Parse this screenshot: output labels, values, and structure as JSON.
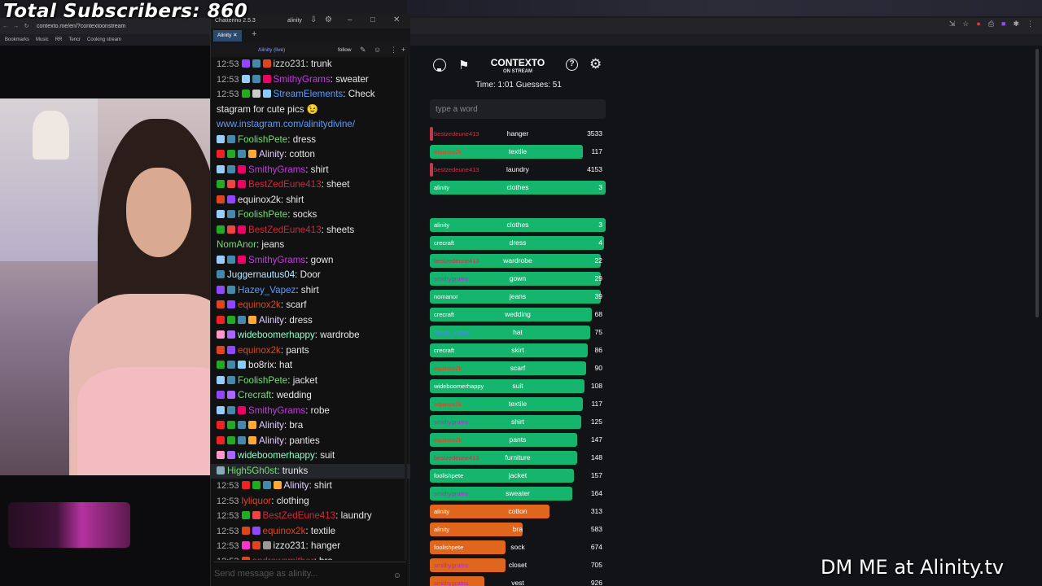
{
  "overlay": {
    "subscribers": "Total Subscribers: 860",
    "dm_text": "DM ME at Alinity.tv"
  },
  "browser": {
    "url": "contexto.me/en/?contextoonstream",
    "bookmarks": [
      "Bookmarks",
      "Music",
      "RR",
      "Tencr",
      "Cooking stream"
    ]
  },
  "game": {
    "title": "CONTEXTO",
    "subtitle": "ON STREAM",
    "stats": "Time: 1:01    Guesses: 51",
    "input_placeholder": "type a word",
    "recent": [
      {
        "player": "bestzedeune413",
        "word": "hanger",
        "rank": 3533,
        "fill": 0,
        "color": "#1b1c20",
        "pcolor": "#c23a4a"
      },
      {
        "player": "equinox2k",
        "word": "textile",
        "rank": 117,
        "fill": 0.87,
        "color": "#16b56e",
        "pcolor": "#e0441e"
      },
      {
        "player": "bestzedeune413",
        "word": "laundry",
        "rank": 4153,
        "fill": 0,
        "color": "#1b1c20",
        "pcolor": "#c23a4a"
      },
      {
        "player": "alinity",
        "word": "clothes",
        "rank": 3,
        "fill": 1,
        "color": "#16b56e",
        "pcolor": "#ffffff"
      }
    ],
    "guesses": [
      {
        "player": "alinity",
        "word": "clothes",
        "rank": 3,
        "fill": 1,
        "color": "#16b56e",
        "pcolor": "#ffffff"
      },
      {
        "player": "crecraft",
        "word": "dress",
        "rank": 4,
        "fill": 0.99,
        "color": "#16b56e",
        "pcolor": "#ffffff"
      },
      {
        "player": "bestzedeune413",
        "word": "wardrobe",
        "rank": 22,
        "fill": 0.97,
        "color": "#16b56e",
        "pcolor": "#c23a4a"
      },
      {
        "player": "smithygrams",
        "word": "gown",
        "rank": 29,
        "fill": 0.97,
        "color": "#16b56e",
        "pcolor": "#b02ad6"
      },
      {
        "player": "nomanor",
        "word": "jeans",
        "rank": 39,
        "fill": 0.97,
        "color": "#16b56e",
        "pcolor": "#ffffff"
      },
      {
        "player": "crecraft",
        "word": "wedding",
        "rank": 68,
        "fill": 0.92,
        "color": "#16b56e",
        "pcolor": "#ffffff"
      },
      {
        "player": "hazey_vapez",
        "word": "hat",
        "rank": 75,
        "fill": 0.91,
        "color": "#16b56e",
        "pcolor": "#4a8aff"
      },
      {
        "player": "crecraft",
        "word": "skirt",
        "rank": 86,
        "fill": 0.9,
        "color": "#16b56e",
        "pcolor": "#ffffff"
      },
      {
        "player": "equinox2k",
        "word": "scarf",
        "rank": 90,
        "fill": 0.89,
        "color": "#16b56e",
        "pcolor": "#e0441e"
      },
      {
        "player": "wideboomerhappy",
        "word": "suit",
        "rank": 108,
        "fill": 0.88,
        "color": "#16b56e",
        "pcolor": "#ffffff"
      },
      {
        "player": "equinox2k",
        "word": "textile",
        "rank": 117,
        "fill": 0.87,
        "color": "#16b56e",
        "pcolor": "#e0441e"
      },
      {
        "player": "smithygrams",
        "word": "shirt",
        "rank": 125,
        "fill": 0.86,
        "color": "#16b56e",
        "pcolor": "#b02ad6"
      },
      {
        "player": "equinox2k",
        "word": "pants",
        "rank": 147,
        "fill": 0.84,
        "color": "#16b56e",
        "pcolor": "#e0441e"
      },
      {
        "player": "bestzedeune413",
        "word": "furniture",
        "rank": 148,
        "fill": 0.84,
        "color": "#16b56e",
        "pcolor": "#c23a4a"
      },
      {
        "player": "foolishpete",
        "word": "jacket",
        "rank": 157,
        "fill": 0.82,
        "color": "#16b56e",
        "pcolor": "#ffffff"
      },
      {
        "player": "smithygrams",
        "word": "sweater",
        "rank": 164,
        "fill": 0.81,
        "color": "#16b56e",
        "pcolor": "#b02ad6"
      },
      {
        "player": "alinity",
        "word": "cotton",
        "rank": 313,
        "fill": 0.68,
        "color": "#e0661e",
        "pcolor": "#ffffff"
      },
      {
        "player": "alinity",
        "word": "bra",
        "rank": 583,
        "fill": 0.53,
        "color": "#e0661e",
        "pcolor": "#ffffff"
      },
      {
        "player": "foolishpete",
        "word": "sock",
        "rank": 674,
        "fill": 0.43,
        "color": "#e0661e",
        "pcolor": "#ffffff"
      },
      {
        "player": "smithygrams",
        "word": "closet",
        "rank": 705,
        "fill": 0.43,
        "color": "#e0661e",
        "pcolor": "#b02ad6"
      },
      {
        "player": "smithygrams",
        "word": "vest",
        "rank": 926,
        "fill": 0.31,
        "color": "#e0661e",
        "pcolor": "#b02ad6"
      }
    ]
  },
  "chat": {
    "app_title": "Chatterino 2.5.3",
    "channel": "alinity",
    "tab": "Alinity",
    "channel_live": "Alinity (live)",
    "follow": "follow",
    "input_placeholder": "Send message as alinity...",
    "messages": [
      {
        "time": "12:53",
        "badges": [
          "#9147ff",
          "#48a",
          "#e0441e"
        ],
        "user": "izzo231",
        "ucolor": "#cfcfcf",
        "text": "trunk"
      },
      {
        "time": "12:53",
        "badges": [
          "#9cf",
          "#48a",
          "#e06"
        ],
        "user": "SmithyGrams",
        "ucolor": "#c838e8",
        "text": "sweater"
      },
      {
        "time": "12:53",
        "badges": [
          "#2a2",
          "#ccc",
          "#8cf"
        ],
        "user": "StreamElements",
        "ucolor": "#5b9bff",
        "text": "Check"
      },
      {
        "time": "",
        "badges": [],
        "user": "",
        "ucolor": "#fff",
        "text": "stagram for cute pics 😉"
      },
      {
        "time": "",
        "badges": [],
        "user": "",
        "ucolor": "#fff",
        "text": "www.instagram.com/alinitydivine/",
        "link": true
      },
      {
        "time": "",
        "badges": [
          "#9cf",
          "#48a"
        ],
        "user": "FoolishPete",
        "ucolor": "#6ee06e",
        "text": "dress"
      },
      {
        "time": "",
        "badges": [
          "#e22",
          "#2a2",
          "#48a",
          "#fa3"
        ],
        "user": "Alinity",
        "ucolor": "#e0d0ff",
        "text": "cotton"
      },
      {
        "time": "",
        "badges": [
          "#9cf",
          "#48a",
          "#e06"
        ],
        "user": "SmithyGrams",
        "ucolor": "#c838e8",
        "text": "shirt"
      },
      {
        "time": "",
        "badges": [
          "#2a2",
          "#e44",
          "#e06"
        ],
        "user": "BestZedEune413",
        "ucolor": "#d0283c",
        "text": "sheet"
      },
      {
        "time": "",
        "badges": [
          "#e0441e",
          "#9147ff"
        ],
        "user": "equinox2k",
        "ucolor": "#e8e8e8",
        "text": "shirt"
      },
      {
        "time": "",
        "badges": [
          "#9cf",
          "#48a"
        ],
        "user": "FoolishPete",
        "ucolor": "#6ee06e",
        "text": "socks"
      },
      {
        "time": "",
        "badges": [
          "#2a2",
          "#e44",
          "#e06"
        ],
        "user": "BestZedEune413",
        "ucolor": "#d0283c",
        "text": "sheets"
      },
      {
        "time": "",
        "badges": [],
        "user": "NomAnor",
        "ucolor": "#6ee06e",
        "text": "jeans"
      },
      {
        "time": "",
        "badges": [
          "#9cf",
          "#48a",
          "#e06"
        ],
        "user": "SmithyGrams",
        "ucolor": "#c838e8",
        "text": "gown"
      },
      {
        "time": "",
        "badges": [
          "#48a"
        ],
        "user": "Juggernautus04",
        "ucolor": "#bde8ff",
        "text": "Door"
      },
      {
        "time": "",
        "badges": [
          "#9147ff",
          "#48a"
        ],
        "user": "Hazey_Vapez",
        "ucolor": "#5b9bff",
        "text": "shirt"
      },
      {
        "time": "",
        "badges": [
          "#e0441e",
          "#9147ff"
        ],
        "user": "equinox2k",
        "ucolor": "#e0441e",
        "text": "scarf"
      },
      {
        "time": "",
        "badges": [
          "#e22",
          "#2a2",
          "#48a",
          "#fa3"
        ],
        "user": "Alinity",
        "ucolor": "#e0d0ff",
        "text": "dress"
      },
      {
        "time": "",
        "badges": [
          "#f9c",
          "#a6f"
        ],
        "user": "wideboomerhappy",
        "ucolor": "#8cffc8",
        "text": "wardrobe"
      },
      {
        "time": "",
        "badges": [
          "#e0441e",
          "#9147ff"
        ],
        "user": "equinox2k",
        "ucolor": "#e0441e",
        "text": "pants"
      },
      {
        "time": "",
        "badges": [
          "#2a2",
          "#48a",
          "#8cf"
        ],
        "user": "bo8rix",
        "ucolor": "#e8e8e8",
        "text": "hat"
      },
      {
        "time": "",
        "badges": [
          "#9cf",
          "#48a"
        ],
        "user": "FoolishPete",
        "ucolor": "#6ee06e",
        "text": "jacket"
      },
      {
        "time": "",
        "badges": [
          "#9147ff",
          "#a6f"
        ],
        "user": "Crecraft",
        "ucolor": "#6ee06e",
        "text": "wedding"
      },
      {
        "time": "",
        "badges": [
          "#9cf",
          "#48a",
          "#e06"
        ],
        "user": "SmithyGrams",
        "ucolor": "#c838e8",
        "text": "robe"
      },
      {
        "time": "",
        "badges": [
          "#e22",
          "#2a2",
          "#48a",
          "#fa3"
        ],
        "user": "Alinity",
        "ucolor": "#e0d0ff",
        "text": "bra"
      },
      {
        "time": "",
        "badges": [
          "#e22",
          "#2a2",
          "#48a",
          "#fa3"
        ],
        "user": "Alinity",
        "ucolor": "#e0d0ff",
        "text": "panties"
      },
      {
        "time": "",
        "badges": [
          "#f9c",
          "#a6f"
        ],
        "user": "wideboomerhappy",
        "ucolor": "#8cffc8",
        "text": "suit"
      },
      {
        "time": "",
        "badges": [
          "#8ab"
        ],
        "user": "High5Gh0st",
        "ucolor": "#6ee06e",
        "text": "trunks",
        "hl": true
      },
      {
        "time": "12:53",
        "badges": [
          "#e22",
          "#2a2",
          "#48a",
          "#fa3"
        ],
        "user": "Alinity",
        "ucolor": "#e0d0ff",
        "text": "shirt"
      },
      {
        "time": "12:53",
        "badges": [],
        "user": "lyliquor",
        "ucolor": "#e0441e",
        "text": "clothing"
      },
      {
        "time": "12:53",
        "badges": [
          "#2a2",
          "#e44"
        ],
        "user": "BestZedEune413",
        "ucolor": "#d0283c",
        "text": "laundry"
      },
      {
        "time": "12:53",
        "badges": [
          "#e0441e",
          "#9147ff"
        ],
        "user": "equinox2k",
        "ucolor": "#e0441e",
        "text": "textile"
      },
      {
        "time": "12:53",
        "badges": [
          "#f3c",
          "#e0441e",
          "#999"
        ],
        "user": "izzo231",
        "ucolor": "#e8e8e8",
        "text": "hanger"
      },
      {
        "time": "12:53",
        "badges": [
          "#e0441e"
        ],
        "user": "andrewsmither",
        "ucolor": "#d0283c",
        "text": "bra"
      }
    ]
  }
}
